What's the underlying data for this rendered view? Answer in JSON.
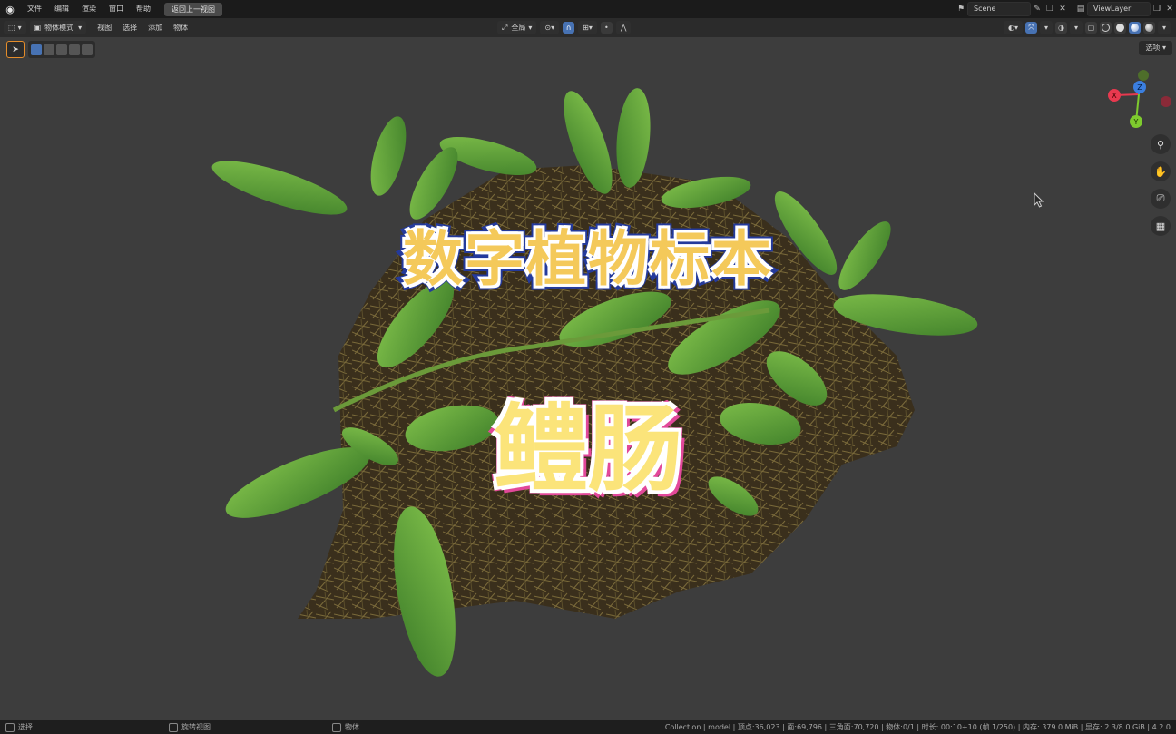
{
  "topbar": {
    "menu": [
      "文件",
      "编辑",
      "渲染",
      "窗口",
      "帮助"
    ],
    "active_tab": "返回上一视图",
    "scene": "Scene",
    "view_layer": "ViewLayer"
  },
  "header": {
    "editor_icon": "3d-viewport-icon",
    "mode": "物体模式",
    "menu": [
      "视图",
      "选择",
      "添加",
      "物体"
    ],
    "orientation": "全局",
    "snap_label": "⊞"
  },
  "options": {
    "label": "选项"
  },
  "gizmo": {
    "x": "X",
    "y": "Y",
    "z": "Z"
  },
  "content": {
    "title": "数字植物标本",
    "name": "鳢肠"
  },
  "status": {
    "select": "选择",
    "rotate": "旋转视图",
    "object": "物体",
    "stats": "Collection | model | 顶点:36,023 | 面:69,796 | 三角面:70,720 | 物体:0/1 | 时长: 00:10+10 (帧 1/250) | 内存: 379.0 MiB | 显存: 2.3/8.0 GiB | 4.2.0"
  },
  "colors": {
    "accent": "#4772b3",
    "x_axis": "#e8394f",
    "y_axis": "#7ecb2e",
    "z_axis": "#3b7fe0",
    "title_fill": "#f4c95a",
    "title_stroke": "#243a9c",
    "name_fill": "#fbe47a",
    "name_stroke": "#e2489a"
  }
}
